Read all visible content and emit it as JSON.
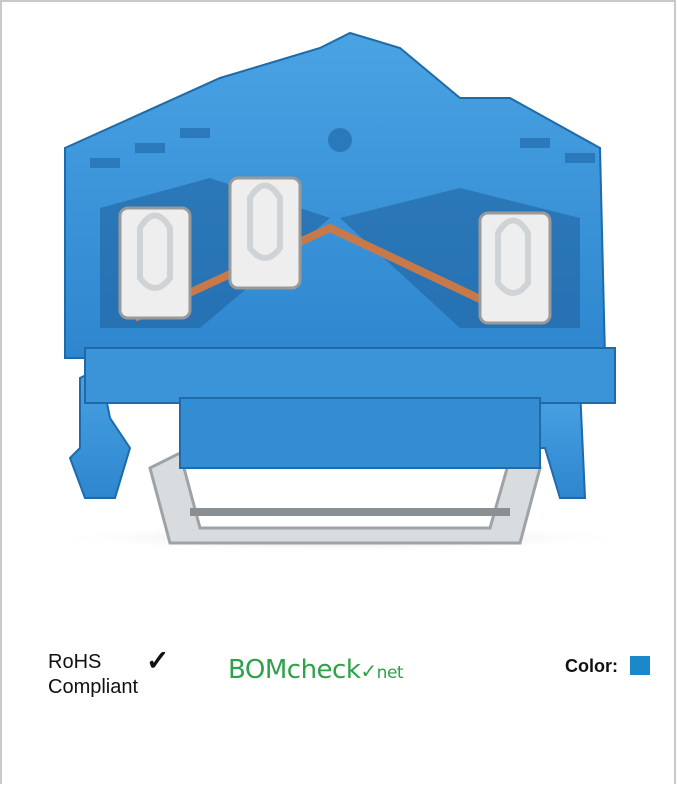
{
  "product": {
    "image_alt": "blue 3-conductor rail-mount terminal block",
    "body_color": "#3f97d9"
  },
  "compliance": {
    "rohs_line1": "RoHS",
    "rohs_line2": "Compliant",
    "check_icon": "check-icon",
    "bom_part1": "BOM",
    "bom_part2": "check",
    "bom_part3": "net",
    "bom_color": "#2fa14a"
  },
  "color_info": {
    "label": "Color:",
    "swatch_color": "#1a88c9"
  }
}
